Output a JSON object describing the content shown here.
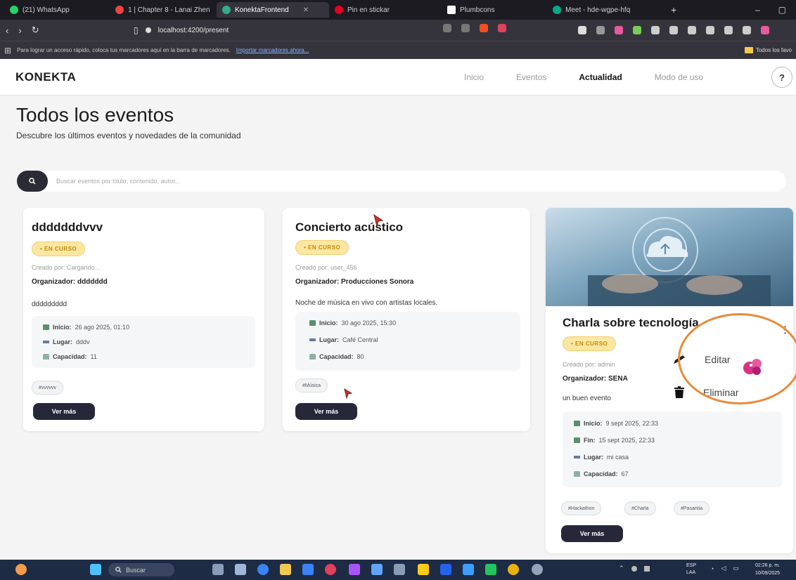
{
  "browser": {
    "tabs": [
      {
        "label": "(21) WhatsApp",
        "color": "#25d366"
      },
      {
        "label": "1 | Chapter 8 - Lanai Zhen",
        "color": "#e44"
      },
      {
        "label": "KonektaFrontend",
        "color": "#3a8",
        "active": true
      },
      {
        "label": "Pin en stickar",
        "color": "#e60023"
      },
      {
        "label": "Plumbcons",
        "color": "#fff"
      },
      {
        "label": "Meet - hde-wgpe-hfq",
        "color": "#0a8"
      }
    ],
    "url": "localhost:4200/present",
    "bookmarks_text": "Para lograr un acceso rápido, coloca tus marcadores aquí en la barra de marcadores.",
    "bookmarks_link": "Importar marcadores ahora...",
    "bookmarks_folder": "Todos los favo"
  },
  "header": {
    "logo": "KONEKTA",
    "nav": [
      "Inicio",
      "Eventos",
      "Actualidad",
      "Modo de uso"
    ],
    "help": "?"
  },
  "page": {
    "title": "Todos los eventos",
    "subtitle": "Descubre los últimos eventos y novedades de la comunidad"
  },
  "search": {
    "placeholder": "Buscar eventos por título, contenido, autor..."
  },
  "cards": [
    {
      "title": "dddddddvvv",
      "badge": "• EN CURSO",
      "created": "Creado por: Cargando...",
      "org_label": "Organizador:",
      "org_value": "ddddddd",
      "desc": "ddddddddd",
      "inicio_label": "Inicio:",
      "inicio": "26 ago 2025, 01:10",
      "lugar_label": "Lugar:",
      "lugar": "dddv",
      "capacidad_label": "Capacidad:",
      "capacidad": "11",
      "tags": [
        "#vvvvvv"
      ],
      "button": "Ver más"
    },
    {
      "title": "Concierto acústico",
      "badge": "• EN CURSO",
      "created": "Creado por: user_456",
      "org_label": "Organizador:",
      "org_value": "Producciones Sonora",
      "desc": "Noche de música en vivo con artistas locales.",
      "inicio_label": "Inicio:",
      "inicio": "30 ago 2025, 15:30",
      "lugar_label": "Lugar:",
      "lugar": "Café Central",
      "capacidad_label": "Capacidad:",
      "capacidad": "80",
      "tags": [
        "#Música"
      ],
      "button": "Ver más"
    },
    {
      "title": "Charla sobre tecnología",
      "badge": "• EN CURSO",
      "created": "Creado por: admin",
      "org_label": "Organizador:",
      "org_value": "SENA",
      "desc": "un buen evento",
      "inicio_label": "Inicio:",
      "inicio": "9 sept 2025, 22:33",
      "fin_label": "Fin:",
      "fin": "15 sept 2025, 22:33",
      "lugar_label": "Lugar:",
      "lugar": "mi casa",
      "capacidad_label": "Capacidad:",
      "capacidad": "67",
      "tags": [
        "#Hackathon",
        "#Charla",
        "#Pasantia"
      ],
      "button": "Ver más",
      "menu": {
        "edit": "Editar",
        "delete": "Eliminar"
      }
    }
  ],
  "taskbar": {
    "search": "Buscar",
    "lang": [
      "ESP",
      "LAA"
    ],
    "time": "02:26 p. m.",
    "date": "10/09/2025"
  }
}
